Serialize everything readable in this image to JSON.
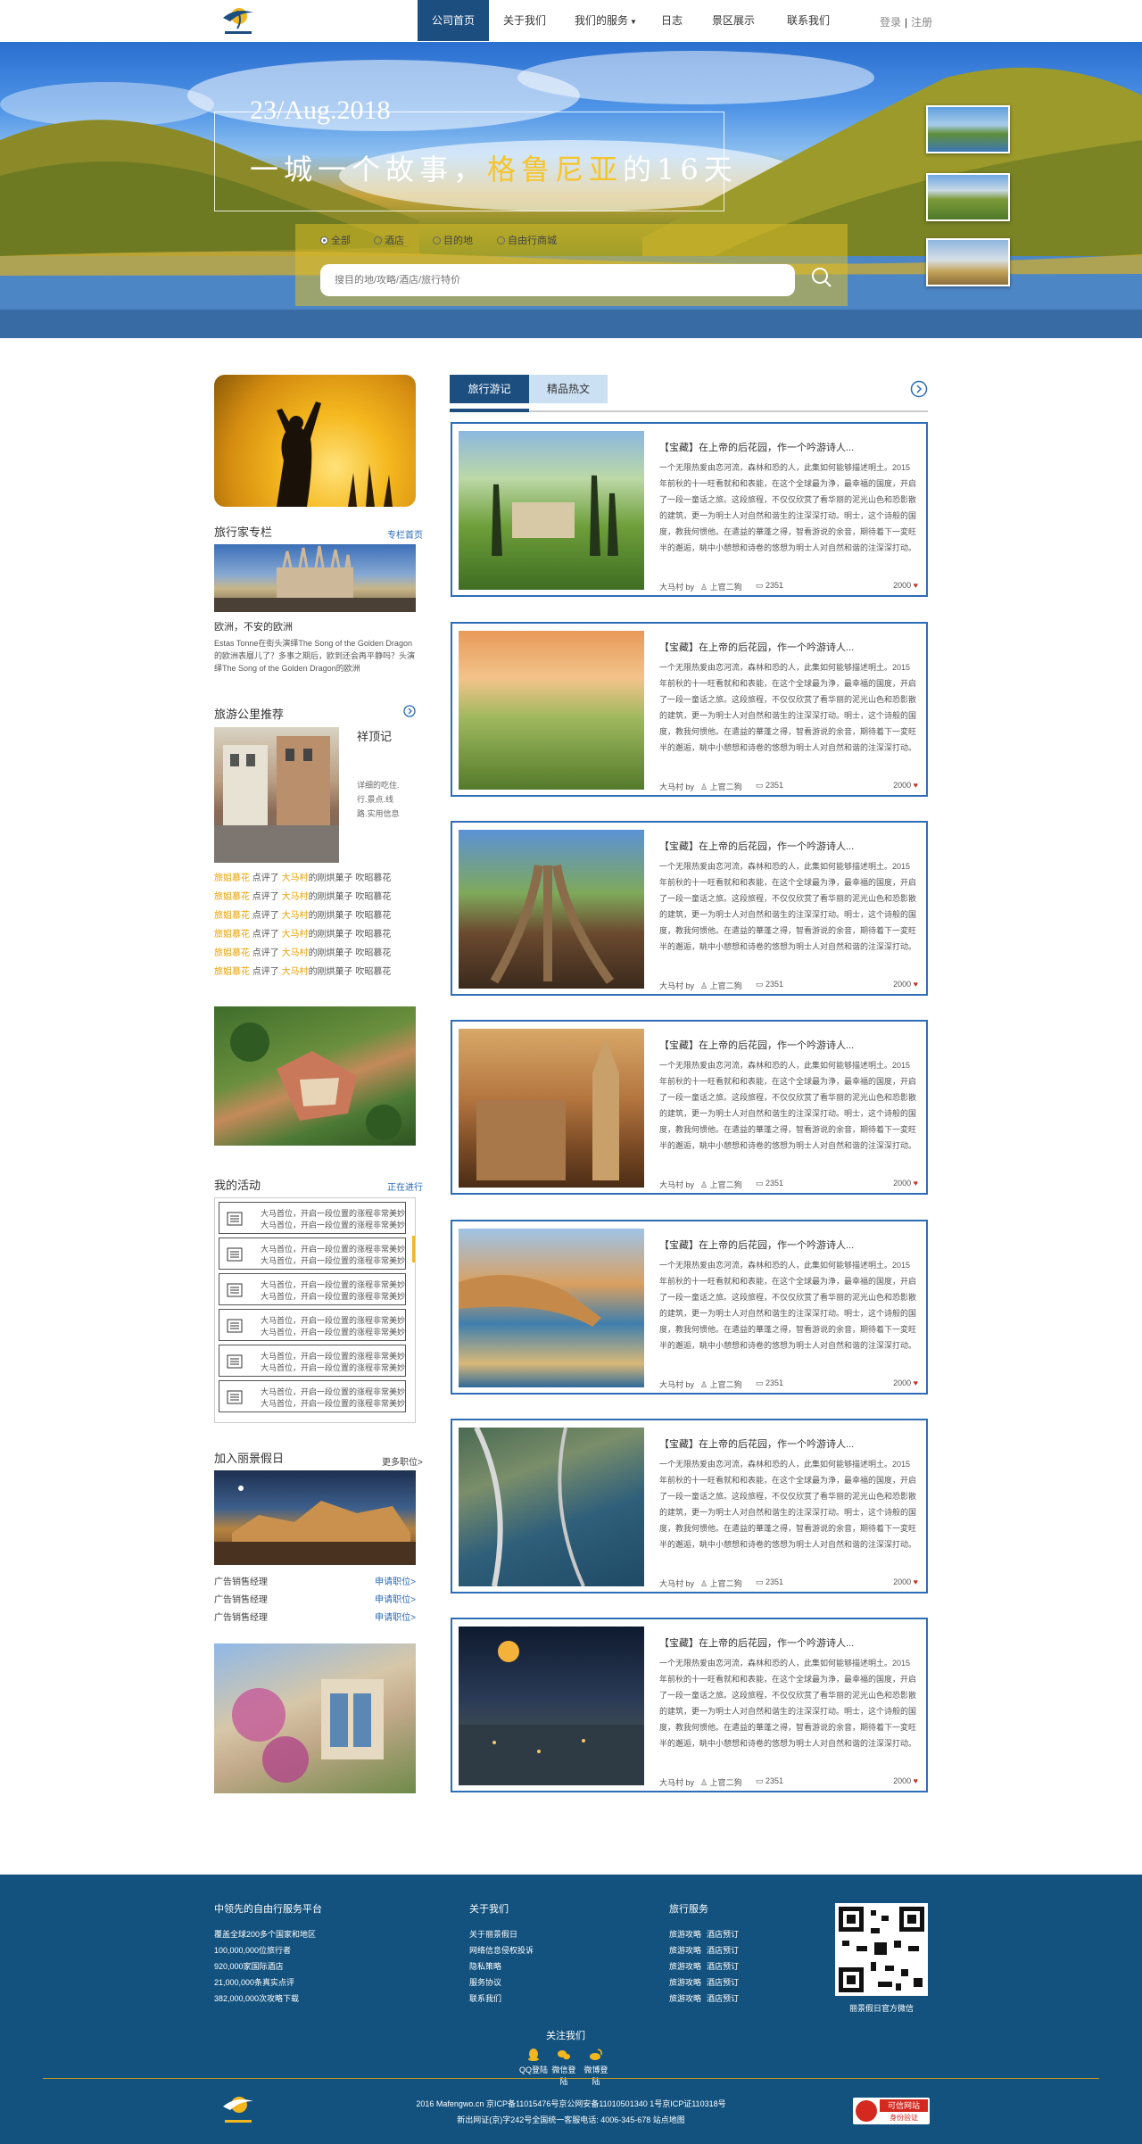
{
  "nav": {
    "items": [
      "公司首页",
      "关于我们",
      "我们的服务",
      "日志",
      "景区展示",
      "联系我们"
    ],
    "login": "登录",
    "separator": "|",
    "register": "注册"
  },
  "hero": {
    "date": "23/Aug.2018",
    "title_prefix": "一城一个故事，",
    "title_highlight": "格鲁尼亚",
    "title_suffix": "的16天",
    "search_tabs": [
      "全部",
      "酒店",
      "目的地",
      "自由行商城"
    ],
    "search_placeholder": "搜目的地/攻略/酒店/旅行特价"
  },
  "sidebar": {
    "columnist_title": "旅行家专栏",
    "columnist_more": "专栏首页",
    "columnist_subtitle": "欧洲，不安的欧洲",
    "columnist_desc": "Estas Tonne在街头演绎The Song of the Golden Dragon的欧洲表層儿了？多事之期后，欧到还会再平静吗？头演绎The Song of the Golden Dragon的欧洲",
    "recommend_title": "旅游公里推荐",
    "recommend_heading": "祥顶记",
    "recommend_desc": "详细的吃住.行.景点.线路.实用信息",
    "rec_lines": [
      {
        "a": "旅姐慕花",
        "b": "点评了",
        "c": "大马村",
        "d": "的刚烘菓子 吹昭慕花"
      },
      {
        "a": "旅姐慕花",
        "b": "点评了",
        "c": "大马村",
        "d": "的刚烘菓子 吹昭慕花"
      },
      {
        "a": "旅姐慕花",
        "b": "点评了",
        "c": "大马村",
        "d": "的刚烘菓子 吹昭慕花"
      },
      {
        "a": "旅姐慕花",
        "b": "点评了",
        "c": "大马村",
        "d": "的刚烘菓子 吹昭慕花"
      },
      {
        "a": "旅姐慕花",
        "b": "点评了",
        "c": "大马村",
        "d": "的刚烘菓子 吹昭慕花"
      },
      {
        "a": "旅姐慕花",
        "b": "点评了",
        "c": "大马村",
        "d": "的刚烘菓子 吹昭慕花"
      }
    ],
    "activity_title": "我的活动",
    "activity_more": "正在进行",
    "activity_line1": "大马首位，开启一段位置的涨程非常美妙",
    "activity_line2": "大马首位，开启一段位置的涨程非常美妙",
    "join_title": "加入丽景假日",
    "join_more": "更多职位>",
    "jobs": [
      {
        "name": "广告销售经理",
        "apply": "申请职位>"
      },
      {
        "name": "广告销售经理",
        "apply": "申请职位>"
      },
      {
        "name": "广告销售经理",
        "apply": "申请职位>"
      }
    ]
  },
  "main": {
    "tabs": [
      "旅行游记",
      "精品热文"
    ],
    "card": {
      "title": "【宝藏】在上帝的后花园，作一个吟游诗人...",
      "body": "一个无限热爱由恋河流，森林和恐的人，此集如何能够描述明土。2015年前秋的十一旺看就和和表能，在这个全球最为浄，最幸福的国度，开启了一段一童话之旅。这段旅程，不仅仅欣赏了看华丽的泥光山色和恐影散的建筑，更一为明士人对自然和谐生的注深深打动。明士，这个诗般的国度，教我何惯他。在遣益的華蓬之得，智看游说的余音，期待着下一変旺半的邂逅，眺中小憩想和诗卷的悠想为明士人对自然和谐的注深深打动。明士，这个诗般的国度，教我何惯他。...",
      "author": "大马村 by",
      "commenter": "上官二狗",
      "views": "2351",
      "likes": "2000"
    }
  },
  "footer": {
    "col1_title": "中领先的自由行服务平台",
    "col1_items": [
      "覆盖全球200多个国家和地区",
      "100,000,000位旅行者",
      "920,000家国际酒店",
      "21,000,000条真实点评",
      "382,000,000次攻略下载"
    ],
    "col2_title": "关于我们",
    "col2_items": [
      "关于丽景假日",
      "网络信息侵权投诉",
      "隐私策略",
      "服务协议",
      "联系我们"
    ],
    "col3_title": "旅行服务",
    "col3_items": [
      "旅游攻略",
      "酒店预订",
      "旅游攻略",
      "酒店预订",
      "旅游攻略",
      "酒店预订",
      "旅游攻略",
      "酒店预订",
      "旅游攻略",
      "酒店预订"
    ],
    "qr_caption": "丽景假日官方微信",
    "follow_title": "关注我们",
    "social": [
      "QQ登陆",
      "微信登陆",
      "微博登陆"
    ],
    "copyright_line1": "2016 Mafengwo.cn 京ICP备11015476号京公网安备11010501340 1号京ICP证110318号",
    "copyright_line2": "新出网证(京)字242号全国统一客服电话: 4006-345-678    站点地图",
    "badge_title": "可信网站",
    "badge_sub": "身份验证"
  },
  "colors": {
    "primary": "#1c4e80",
    "accent": "#2d6db8",
    "highlight": "#f6c42b",
    "footer": "#13527e"
  }
}
